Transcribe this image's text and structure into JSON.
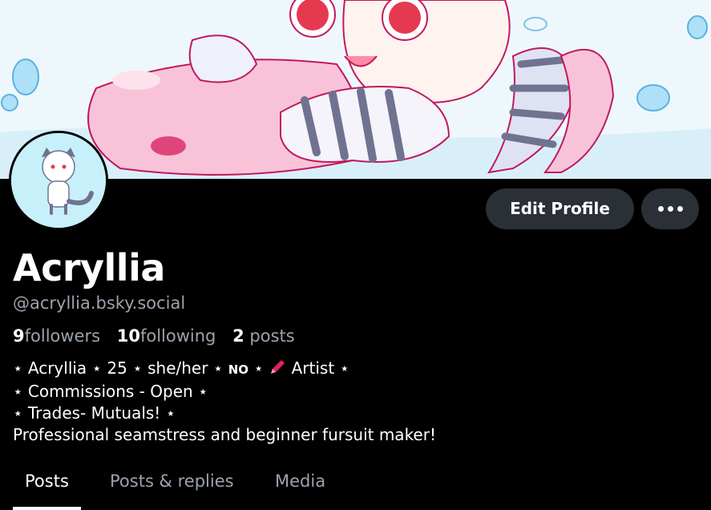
{
  "profile": {
    "display_name": "Acryllia",
    "handle": "@acryllia.bsky.social",
    "stats": {
      "followers_count": "9",
      "followers_label": "followers",
      "following_count": "10",
      "following_label": "following",
      "posts_count": "2",
      "posts_label": "posts"
    },
    "bio": {
      "line1_a": "⋆ Acryllia ⋆ 25 ⋆ she/her ⋆ ",
      "line1_no": "NO",
      "line1_b": " ⋆ ",
      "line1_c": " Artist ⋆",
      "line2": "⋆ Commissions - Open ⋆",
      "line3": "⋆ Trades- Mutuals! ⋆",
      "line4": "Professional seamstress and beginner fursuit maker!"
    }
  },
  "actions": {
    "edit_profile_label": "Edit Profile",
    "more_icon": "ellipsis-icon"
  },
  "tabs": [
    {
      "label": "Posts",
      "active": true
    },
    {
      "label": "Posts & replies",
      "active": false
    },
    {
      "label": "Media",
      "active": false
    }
  ],
  "colors": {
    "background": "#000000",
    "button_bg": "#2b2f36",
    "muted_text": "#9aa3ad",
    "banner_pink": "#f6b6d2",
    "accent_pencil": "#e0245e"
  }
}
